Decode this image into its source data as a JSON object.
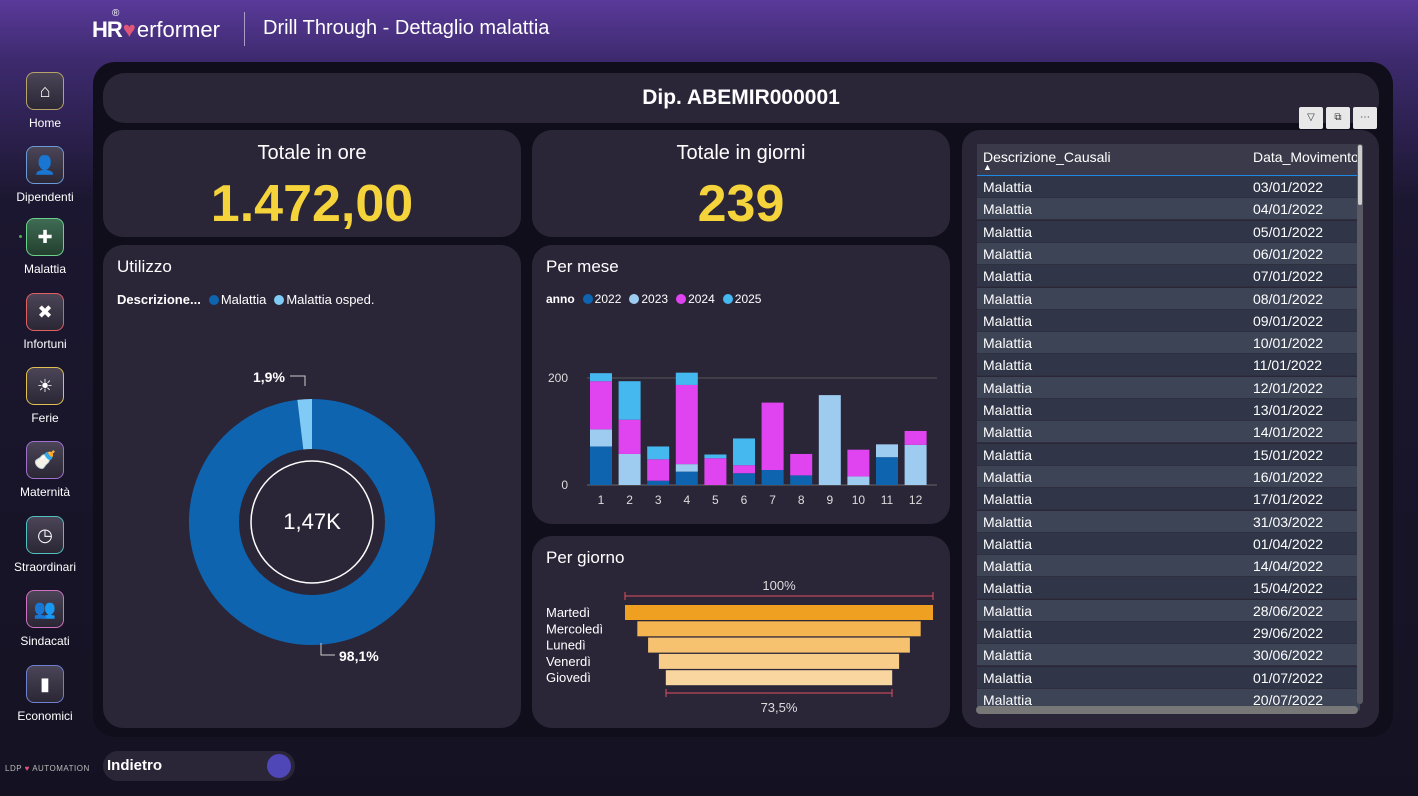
{
  "app": {
    "logo_hr": "HR",
    "logo_rest": "erformer",
    "logo_reg": "®",
    "title": "Drill Through - Dettaglio malattia",
    "brand_left": "LDP",
    "brand_right": "AUTOMATION"
  },
  "sidebar": {
    "items": [
      {
        "label": "Home",
        "icon": "home-icon"
      },
      {
        "label": "Dipendenti",
        "icon": "user-icon"
      },
      {
        "label": "Malattia",
        "icon": "medical-kit-icon"
      },
      {
        "label": "Infortuni",
        "icon": "bandage-icon"
      },
      {
        "label": "Ferie",
        "icon": "sun-icon"
      },
      {
        "label": "Maternità",
        "icon": "baby-bottle-icon"
      },
      {
        "label": "Straordinari",
        "icon": "clock-icon"
      },
      {
        "label": "Sindacati",
        "icon": "group-icon"
      },
      {
        "label": "Economici",
        "icon": "bar-chart-icon"
      }
    ]
  },
  "header": {
    "title": "Dip. ABEMIR000001"
  },
  "kpi": {
    "ore_title": "Totale in ore",
    "ore_value": "1.472,00",
    "giorni_title": "Totale in giorni",
    "giorni_value": "239"
  },
  "utilizzo": {
    "title": "Utilizzo",
    "legend_title": "Descrizione...",
    "legend": [
      "Malattia",
      "Malattia osped."
    ],
    "center_label": "1,47K",
    "small_label": "1,9%",
    "big_label": "98,1%"
  },
  "per_mese": {
    "title": "Per mese",
    "legend_title": "anno",
    "legend": [
      "2022",
      "2023",
      "2024",
      "2025"
    ]
  },
  "per_giorno": {
    "title": "Per giorno",
    "top_label": "100%",
    "bottom_label": "73,5%"
  },
  "table": {
    "col1": "Descrizione_Causali",
    "col2": "Data_Movimento",
    "rows": [
      [
        "Malattia",
        "03/01/2022"
      ],
      [
        "Malattia",
        "04/01/2022"
      ],
      [
        "Malattia",
        "05/01/2022"
      ],
      [
        "Malattia",
        "06/01/2022"
      ],
      [
        "Malattia",
        "07/01/2022"
      ],
      [
        "Malattia",
        "08/01/2022"
      ],
      [
        "Malattia",
        "09/01/2022"
      ],
      [
        "Malattia",
        "10/01/2022"
      ],
      [
        "Malattia",
        "11/01/2022"
      ],
      [
        "Malattia",
        "12/01/2022"
      ],
      [
        "Malattia",
        "13/01/2022"
      ],
      [
        "Malattia",
        "14/01/2022"
      ],
      [
        "Malattia",
        "15/01/2022"
      ],
      [
        "Malattia",
        "16/01/2022"
      ],
      [
        "Malattia",
        "17/01/2022"
      ],
      [
        "Malattia",
        "31/03/2022"
      ],
      [
        "Malattia",
        "01/04/2022"
      ],
      [
        "Malattia",
        "14/04/2022"
      ],
      [
        "Malattia",
        "15/04/2022"
      ],
      [
        "Malattia",
        "28/06/2022"
      ],
      [
        "Malattia",
        "29/06/2022"
      ],
      [
        "Malattia",
        "30/06/2022"
      ],
      [
        "Malattia",
        "01/07/2022"
      ],
      [
        "Malattia",
        "20/07/2022"
      ]
    ]
  },
  "back_button": {
    "label": "Indietro"
  },
  "colors": {
    "y2022": "#0f64b0",
    "y2023": "#9ecbf0",
    "y2024": "#e044f0",
    "y2025": "#45b8f0",
    "donut_main": "#0f64b0",
    "donut_small": "#7fcbf5",
    "kpi": "#f5d33a",
    "funnel": [
      "#f0a020",
      "#f4b550",
      "#f6c270",
      "#f8cd8a",
      "#f9d6a0"
    ]
  },
  "chart_data": [
    {
      "type": "pie",
      "title": "Utilizzo",
      "categories": [
        "Malattia",
        "Malattia osped."
      ],
      "values": [
        98.1,
        1.9
      ],
      "total_label": "1,47K"
    },
    {
      "type": "bar",
      "title": "Per mese",
      "stacked": true,
      "categories": [
        "1",
        "2",
        "3",
        "4",
        "5",
        "6",
        "7",
        "8",
        "9",
        "10",
        "11",
        "12"
      ],
      "ylim": [
        0,
        210
      ],
      "yticks": [
        0,
        200
      ],
      "series": [
        {
          "name": "2022",
          "values": [
            72,
            0,
            8,
            25,
            0,
            22,
            28,
            18,
            0,
            0,
            52,
            0
          ]
        },
        {
          "name": "2023",
          "values": [
            32,
            58,
            0,
            14,
            0,
            0,
            0,
            0,
            168,
            16,
            24,
            75
          ]
        },
        {
          "name": "2024",
          "values": [
            90,
            64,
            40,
            148,
            50,
            15,
            126,
            40,
            0,
            50,
            0,
            26
          ]
        },
        {
          "name": "2025",
          "values": [
            15,
            72,
            24,
            23,
            7,
            50,
            0,
            0,
            0,
            0,
            0,
            0
          ]
        }
      ]
    },
    {
      "type": "bar",
      "title": "Per giorno",
      "categories": [
        "Martedì",
        "Mercoledì",
        "Lunedì",
        "Venerdì",
        "Giovedì"
      ],
      "values": [
        100,
        92,
        85,
        78,
        73.5
      ],
      "unit": "%"
    }
  ]
}
